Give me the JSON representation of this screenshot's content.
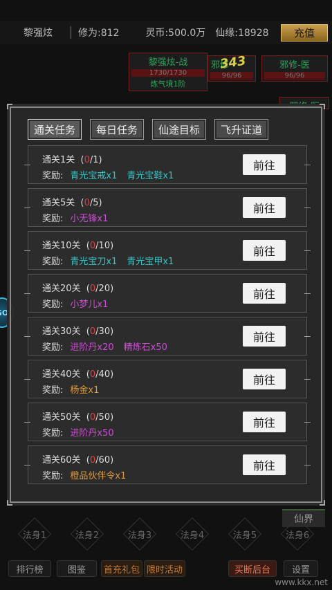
{
  "topbar": {
    "player_name": "黎强炫",
    "cultivation": "修为:812",
    "spirit_coins": "灵币:500.0万",
    "immortal_fate": "仙缘:18928",
    "recharge_label": "充值"
  },
  "team": [
    {
      "name": "黎强炫-战",
      "hp": "1730/1730",
      "realm": "炼气境1阶"
    },
    {
      "name": "邪修",
      "hp": "96/96"
    },
    {
      "name": "邪修-医",
      "hp": "96/96"
    },
    {
      "name": "邪修-医"
    }
  ],
  "damage_text": "343",
  "modal": {
    "tabs": [
      {
        "label": "通关任务",
        "active": true
      },
      {
        "label": "每日任务",
        "active": false
      },
      {
        "label": "仙途目标",
        "active": false
      },
      {
        "label": "飞升证道",
        "active": false
      }
    ],
    "reward_prefix": "奖励:",
    "go_label": "前往",
    "tasks": [
      {
        "title": "通关1关",
        "current": "0",
        "total": "/1)",
        "rewards": [
          {
            "text": "青光宝戒x1",
            "color": "cyan"
          },
          {
            "text": "青光宝鞋x1",
            "color": "cyan"
          }
        ]
      },
      {
        "title": "通关5关",
        "current": "0",
        "total": "/5)",
        "rewards": [
          {
            "text": "小无锋x1",
            "color": "magenta"
          }
        ]
      },
      {
        "title": "通关10关",
        "current": "0",
        "total": "/10)",
        "rewards": [
          {
            "text": "青光宝刀x1",
            "color": "cyan"
          },
          {
            "text": "青光宝甲x1",
            "color": "cyan"
          }
        ]
      },
      {
        "title": "通关20关",
        "current": "0",
        "total": "/20)",
        "rewards": [
          {
            "text": "小梦儿x1",
            "color": "magenta"
          }
        ]
      },
      {
        "title": "通关30关",
        "current": "0",
        "total": "/30)",
        "rewards": [
          {
            "text": "进阶丹x20",
            "color": "magenta"
          },
          {
            "text": "精炼石x50",
            "color": "magenta"
          }
        ]
      },
      {
        "title": "通关40关",
        "current": "0",
        "total": "/40)",
        "rewards": [
          {
            "text": "杨金x1",
            "color": "orange"
          }
        ]
      },
      {
        "title": "通关50关",
        "current": "0",
        "total": "/50)",
        "rewards": [
          {
            "text": "进阶丹x50",
            "color": "magenta"
          }
        ]
      },
      {
        "title": "通关60关",
        "current": "0",
        "total": "/60)",
        "rewards": [
          {
            "text": "橙品伙伴令x1",
            "color": "orange"
          }
        ]
      }
    ]
  },
  "body_slots": [
    "法身1",
    "法身2",
    "法身3",
    "法身4",
    "法身5",
    "法身6"
  ],
  "fairy_realm_label": "仙界",
  "bottom_bar": {
    "ranking": "排行榜",
    "illustrated": "图鉴",
    "first_recharge": "首充礼包",
    "limited_event": "限时活动",
    "backstage": "买断后台",
    "settings": "设置"
  },
  "watermark": "www.kkx.net",
  "badge_text": "GO",
  "colors": {
    "cyan": "#35c7c7",
    "magenta": "#d14ad8",
    "orange": "#e09a3a",
    "progress_red": "#e04040",
    "gold": "#caa04a"
  }
}
